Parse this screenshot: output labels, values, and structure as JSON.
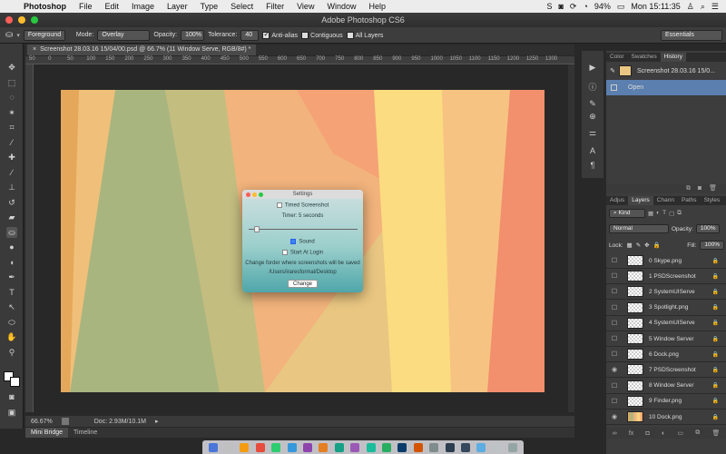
{
  "menubar": {
    "app_name": "Photoshop",
    "items": [
      "File",
      "Edit",
      "Image",
      "Layer",
      "Type",
      "Select",
      "Filter",
      "View",
      "Window",
      "Help"
    ],
    "battery": "94%",
    "clock": "Mon 15:11:35"
  },
  "window": {
    "title": "Adobe Photoshop CS6"
  },
  "options": {
    "fill_source": "Foreground",
    "mode_label": "Mode:",
    "mode_value": "Overlay",
    "opacity_label": "Opacity:",
    "opacity_value": "100%",
    "tolerance_label": "Tolerance:",
    "tolerance_value": "40",
    "antialias_label": "Anti-alias",
    "contiguous_label": "Contiguous",
    "all_layers_label": "All Layers",
    "workspace": "Essentials"
  },
  "document": {
    "tab_title": "Screenshot 28.03.16 15/04/00.psd @ 66.7% (11 Window Serve, RGB/8#) *",
    "ruler_ticks": [
      "50",
      "0",
      "50",
      "100",
      "150",
      "200",
      "250",
      "300",
      "350",
      "400",
      "450",
      "500",
      "550",
      "600",
      "650",
      "700",
      "750",
      "800",
      "850",
      "900",
      "950",
      "1000",
      "1050",
      "1100",
      "1150",
      "1200",
      "1250",
      "1300"
    ],
    "zoom": "66.67%",
    "doc_size": "Doc: 2.93M/10.1M"
  },
  "bottom_tabs": [
    "Mini Bridge",
    "Timeline"
  ],
  "dialog": {
    "title": "Settings",
    "timed_label": "Timed Screenshot",
    "timer_text": "Timer: 5 seconds",
    "sound_label": "Sound",
    "login_label": "Start At Login",
    "folder_text": "Change forder where screenshots will be saved",
    "path": "/Users/iraresformal/Desktop",
    "change_button": "Change"
  },
  "panels": {
    "top_tabs": [
      "Color",
      "Swatches",
      "History"
    ],
    "history_snapshot": "Screenshot 28.03.16 15/0...",
    "history_open": "Open",
    "layer_tabs": [
      "Adjus",
      "Layers",
      "Chann",
      "Paths",
      "Styles"
    ],
    "kind_label": "Kind",
    "blend_mode": "Normal",
    "opacity_label": "Opacity:",
    "opacity_value": "100%",
    "lock_label": "Lock:",
    "fill_label": "Fill:",
    "fill_value": "100%",
    "layers": [
      {
        "name": "0 Skype.png",
        "visible": false
      },
      {
        "name": "1 PSDScreenshot",
        "visible": false
      },
      {
        "name": "2 SystemUIServe",
        "visible": false
      },
      {
        "name": "3 Spotlight.png",
        "visible": false
      },
      {
        "name": "4 SystemUIServe",
        "visible": false
      },
      {
        "name": "5 Window Server",
        "visible": false
      },
      {
        "name": "6 Dock.png",
        "visible": false
      },
      {
        "name": "7 PSDScreenshot",
        "visible": true
      },
      {
        "name": "8 Window Server",
        "visible": false
      },
      {
        "name": "9 Finder.png",
        "visible": false
      },
      {
        "name": "10 Dock.png",
        "visible": true
      }
    ]
  },
  "colors": {
    "canvas": [
      "#f3c98b",
      "#e8c584",
      "#a8b780",
      "#f4a97a",
      "#fbdc7f",
      "#f18f6e"
    ],
    "dialog_gradient": [
      "#cfe0e0",
      "#4fa6a9"
    ]
  }
}
